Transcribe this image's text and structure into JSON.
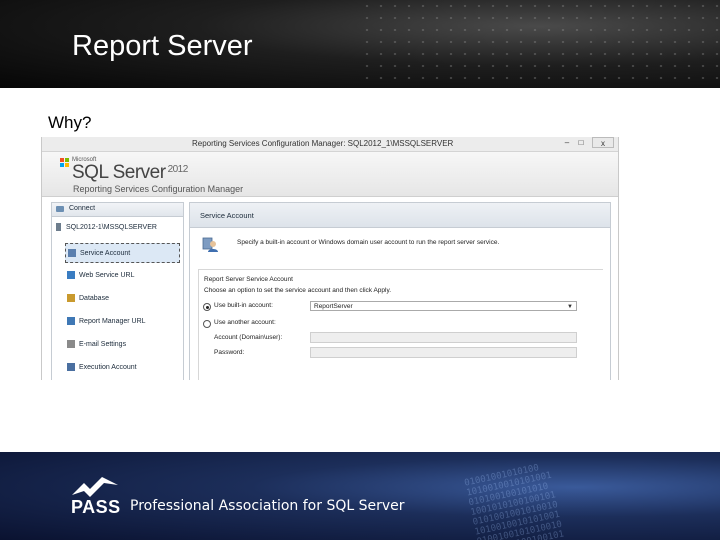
{
  "slide": {
    "title": "Report Server",
    "question": "Why?"
  },
  "window": {
    "title": "Reporting Services Configuration Manager: SQL2012_1\\MSSQLSERVER",
    "min_glyph": "–",
    "max_glyph": "□",
    "close_glyph": "x"
  },
  "banner": {
    "ms_small": "Microsoft",
    "product": "SQL Server",
    "version": "2012",
    "subtitle": "Reporting Services Configuration Manager"
  },
  "nav": {
    "connect_label": "Connect",
    "server_label": "SQL2012-1\\MSSQLSERVER",
    "items": [
      {
        "label": "Service Account",
        "icon": "service-account-icon",
        "color": "#5b7fae",
        "selected": true
      },
      {
        "label": "Web Service URL",
        "icon": "globe-icon",
        "color": "#3a7dc2",
        "selected": false
      },
      {
        "label": "Database",
        "icon": "database-icon",
        "color": "#c99a2e",
        "selected": false
      },
      {
        "label": "Report Manager URL",
        "icon": "report-manager-icon",
        "color": "#3f78b5",
        "selected": false
      },
      {
        "label": "E-mail Settings",
        "icon": "email-icon",
        "color": "#8a8a8a",
        "selected": false
      },
      {
        "label": "Execution Account",
        "icon": "execution-account-icon",
        "color": "#4a6fa0",
        "selected": false
      }
    ]
  },
  "content": {
    "header": "Service Account",
    "description": "Specify a built-in account or Windows domain user account to run the report server service.",
    "group_title": "Report Server Service Account",
    "group_text": "Choose an option to set the service account and then click Apply.",
    "option_builtin": "Use built-in account:",
    "builtin_value": "ReportServer",
    "option_another": "Use another account:",
    "account_label": "Account (Domain\\user):",
    "password_label": "Password:"
  },
  "footer": {
    "logo_text": "PASS",
    "association": "Professional Association for SQL Server",
    "binary_text": "01001001010100\n1010010010101001\n010100100101010\n1001010100100101\n0101001001010010\n1010010010101001\n0100100101010010\n1001010100100101\n0101001001010100"
  },
  "colors": {
    "header_bg": "#111111",
    "footer_bg": "#1c2e5a",
    "selection_bg": "#dce8f5"
  }
}
